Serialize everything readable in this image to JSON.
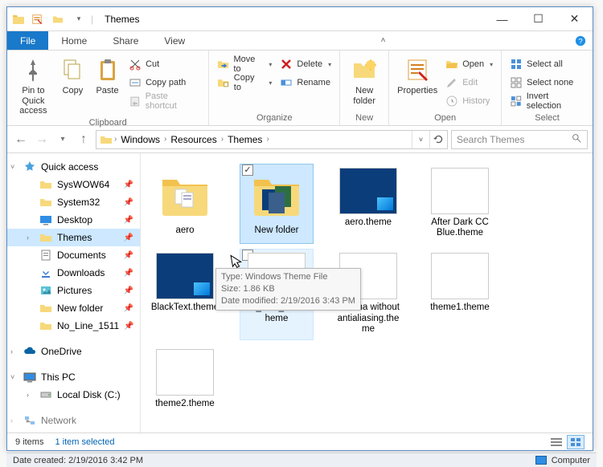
{
  "window": {
    "title": "Themes"
  },
  "tabs": {
    "file": "File",
    "home": "Home",
    "share": "Share",
    "view": "View"
  },
  "ribbon": {
    "clipboard": {
      "label": "Clipboard",
      "pin": "Pin to Quick access",
      "copy": "Copy",
      "paste": "Paste",
      "cut": "Cut",
      "copypath": "Copy path",
      "pasteshortcut": "Paste shortcut"
    },
    "organize": {
      "label": "Organize",
      "moveto": "Move to",
      "copyto": "Copy to",
      "delete": "Delete",
      "rename": "Rename"
    },
    "new": {
      "label": "New",
      "newfolder": "New folder"
    },
    "open": {
      "label": "Open",
      "properties": "Properties",
      "open": "Open",
      "edit": "Edit",
      "history": "History"
    },
    "select": {
      "label": "Select",
      "selectall": "Select all",
      "selectnone": "Select none",
      "invert": "Invert selection"
    }
  },
  "address": {
    "crumbs": [
      "Windows",
      "Resources",
      "Themes"
    ]
  },
  "search": {
    "placeholder": "Search Themes"
  },
  "nav": {
    "quickaccess": "Quick access",
    "items": [
      {
        "label": "SysWOW64"
      },
      {
        "label": "System32"
      },
      {
        "label": "Desktop"
      },
      {
        "label": "Themes"
      },
      {
        "label": "Documents"
      },
      {
        "label": "Downloads"
      },
      {
        "label": "Pictures"
      },
      {
        "label": "New folder"
      },
      {
        "label": "No_Line_1511"
      }
    ],
    "onedrive": "OneDrive",
    "thispc": "This PC",
    "localdisk": "Local Disk (C:)",
    "network": "Network"
  },
  "files": [
    {
      "name": "aero",
      "kind": "folder"
    },
    {
      "name": "New folder",
      "kind": "folder",
      "selected": true
    },
    {
      "name": "aero.theme",
      "kind": "single"
    },
    {
      "name": "After Dark CC Blue.theme",
      "kind": "dark"
    },
    {
      "name": "BlackText.theme",
      "kind": "single"
    },
    {
      "name": "No_Line_1511.theme",
      "kind": "gray",
      "hover": true
    },
    {
      "name": "tahoma without antialiasing.theme",
      "kind": "mix"
    },
    {
      "name": "theme1.theme",
      "kind": "color"
    },
    {
      "name": "theme2.theme",
      "kind": "color"
    }
  ],
  "tooltip": {
    "line1": "Type: Windows Theme File",
    "line2": "Size: 1.86 KB",
    "line3": "Date modified: 2/19/2016 3:43 PM"
  },
  "status": {
    "count": "9 items",
    "selected": "1 item selected"
  },
  "footer": {
    "date": "Date created: 2/19/2016 3:42 PM",
    "computer": "Computer"
  }
}
